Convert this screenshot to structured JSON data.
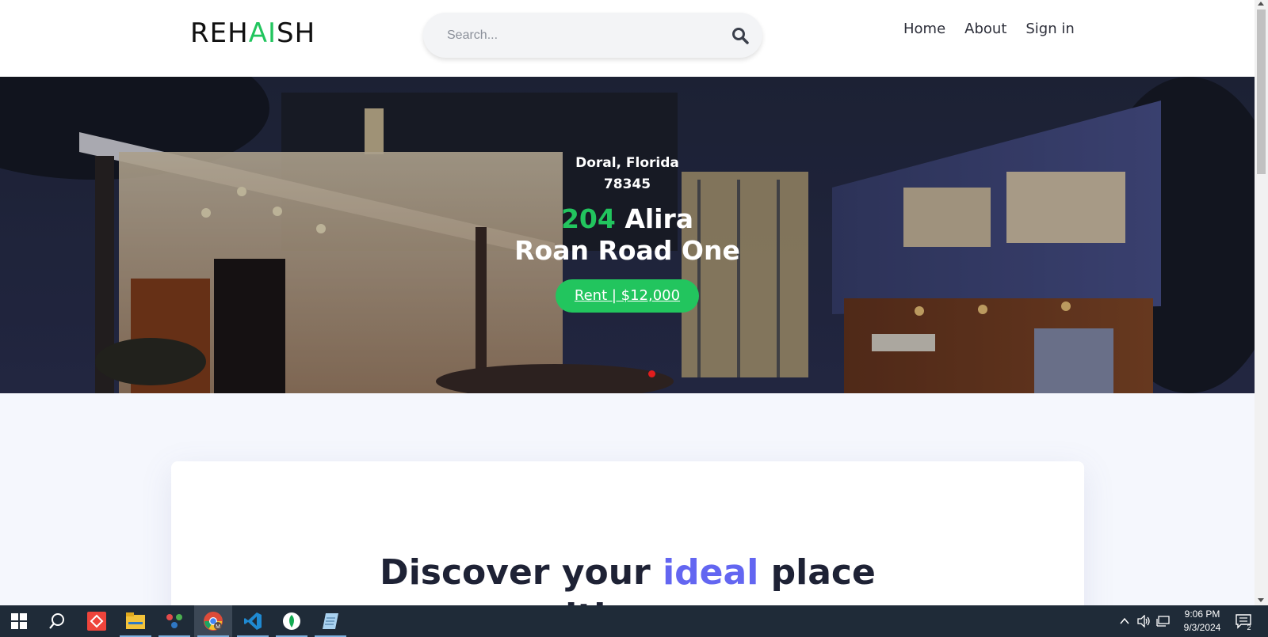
{
  "header": {
    "logo": {
      "part1": "REH",
      "part2": "AI",
      "part3": "SH"
    },
    "search": {
      "placeholder": "Search..."
    },
    "nav": [
      {
        "label": "Home"
      },
      {
        "label": "About"
      },
      {
        "label": "Sign in"
      }
    ]
  },
  "hero": {
    "location_line1": "Doral, Florida",
    "location_line2": "78345",
    "title_number": "204",
    "title_rest_line1": "Alira",
    "title_line2": "Roan Road One",
    "button_label": "Rent | $12,000"
  },
  "card": {
    "heading_part1": "Discover your",
    "heading_highlight": "ideal",
    "heading_part2": "place",
    "heading_line2": "with ease"
  },
  "taskbar": {
    "time": "9:06 PM",
    "date": "9/3/2024",
    "notification_count": "2"
  },
  "colors": {
    "accent_green": "#22c55e",
    "accent_indigo": "#6366f1",
    "carousel_dot": "#e11d1d"
  }
}
